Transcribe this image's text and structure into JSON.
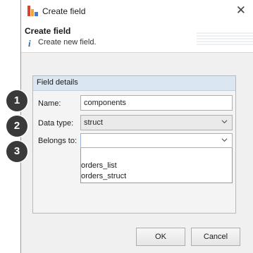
{
  "window": {
    "title": "Create field",
    "close_glyph": "✕"
  },
  "header": {
    "title": "Create field",
    "info_icon": "i",
    "description": "Create new field."
  },
  "panel": {
    "title": "Field details"
  },
  "form": {
    "name_label": "Name:",
    "name_value": "components",
    "data_type_label": "Data type:",
    "data_type_value": "struct",
    "belongs_to_label": "Belongs to:",
    "belongs_to_value": "",
    "belongs_to_options": [
      "orders_list",
      "orders_struct"
    ]
  },
  "buttons": {
    "ok": "OK",
    "cancel": "Cancel"
  },
  "callouts": [
    "1",
    "2",
    "3"
  ]
}
